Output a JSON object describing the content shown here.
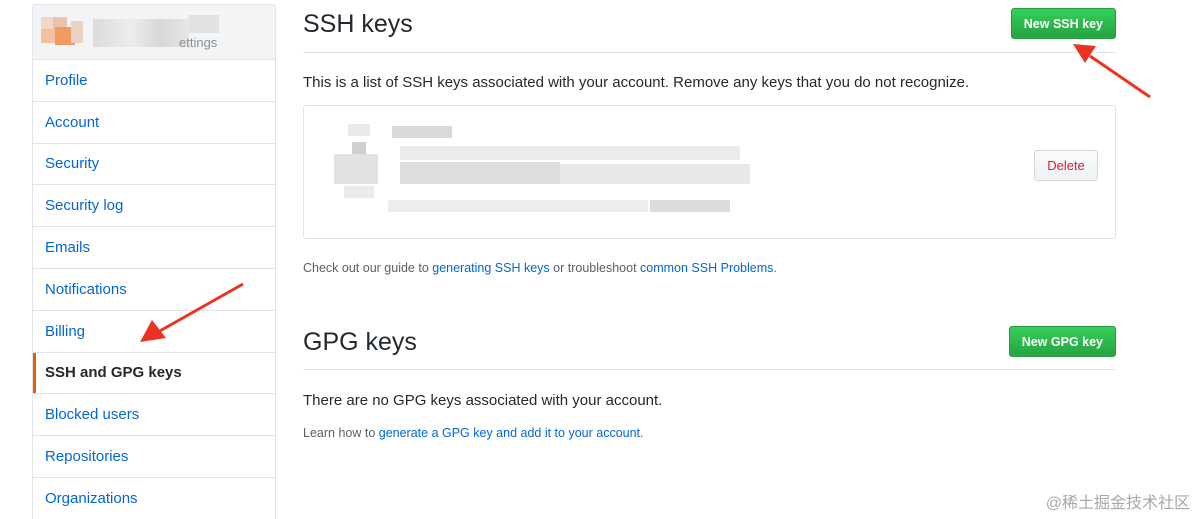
{
  "sidebar": {
    "header_suffix": "ettings",
    "items": [
      {
        "label": "Profile"
      },
      {
        "label": "Account"
      },
      {
        "label": "Security"
      },
      {
        "label": "Security log"
      },
      {
        "label": "Emails"
      },
      {
        "label": "Notifications"
      },
      {
        "label": "Billing"
      },
      {
        "label": "SSH and GPG keys",
        "selected": true
      },
      {
        "label": "Blocked users"
      },
      {
        "label": "Repositories"
      },
      {
        "label": "Organizations"
      }
    ]
  },
  "ssh": {
    "title": "SSH keys",
    "new_button": "New SSH key",
    "description": "This is a list of SSH keys associated with your account. Remove any keys that you do not recognize.",
    "delete_button": "Delete",
    "guide_prefix": "Check out our guide to ",
    "guide_link": "generating SSH keys",
    "guide_middle": " or troubleshoot ",
    "problems_link": "common SSH Problems",
    "guide_suffix": "."
  },
  "gpg": {
    "title": "GPG keys",
    "new_button": "New GPG key",
    "empty_text": "There are no GPG keys associated with your account.",
    "learn_prefix": "Learn how to ",
    "learn_link": "generate a GPG key and add it to your account",
    "learn_suffix": "."
  },
  "watermark": "@稀土掘金技术社区",
  "colors": {
    "link": "#0366d6",
    "green_button": "#28a745",
    "danger": "#cb2431",
    "selected_marker": "#e36209",
    "annotation_arrow": "#ea3323"
  }
}
